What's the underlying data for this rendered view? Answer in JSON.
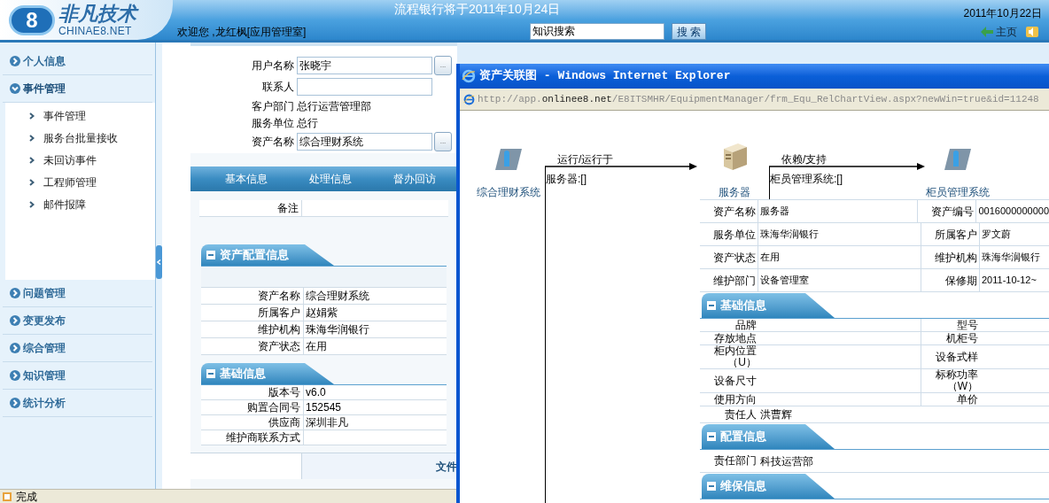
{
  "header": {
    "logo_mark": "8",
    "logo_title": "非凡技术",
    "logo_subtitle": "CHINAE8.NET",
    "welcome": "欢迎您 ,龙红枫[应用管理室]",
    "notice": "流程银行将于2011年10月24日",
    "date": "2011年10月22日",
    "search": {
      "value": "知识搜索"
    },
    "search_button": "搜 索",
    "home_link": "主页"
  },
  "sidebar": {
    "groups": [
      {
        "label": "个人信息",
        "expanded": false
      },
      {
        "label": "事件管理",
        "expanded": true,
        "children": [
          {
            "label": "事件管理"
          },
          {
            "label": "服务台批量接收"
          },
          {
            "label": "未回访事件"
          },
          {
            "label": "工程师管理"
          },
          {
            "label": "邮件报障"
          }
        ]
      },
      {
        "label": "问题管理",
        "expanded": false
      },
      {
        "label": "变更发布",
        "expanded": false
      },
      {
        "label": "综合管理",
        "expanded": false
      },
      {
        "label": "知识管理",
        "expanded": false
      },
      {
        "label": "统计分析",
        "expanded": false
      }
    ]
  },
  "form": {
    "fields": [
      {
        "label": "用户名称",
        "kind": "input",
        "value": "张晓宇",
        "picker": "..."
      },
      {
        "label": "联系人",
        "kind": "input"
      },
      {
        "label": "客户部门",
        "kind": "text",
        "value": "总行运营管理部"
      },
      {
        "label": "服务单位",
        "kind": "text",
        "value": "总行"
      },
      {
        "label": "资产名称",
        "kind": "input",
        "value": "综合理财系统",
        "picker": "..."
      }
    ]
  },
  "tabs": [
    {
      "label": "基本信息",
      "selected": false
    },
    {
      "label": "处理信息",
      "selected": false
    },
    {
      "label": "督办回访",
      "selected": false
    }
  ],
  "remark": {
    "label": "备注"
  },
  "sections": [
    {
      "title": "资产配置信息",
      "rows": [
        {
          "label": "资产名称",
          "value": "综合理财系统"
        },
        {
          "label": "所属客户",
          "value": "赵娟紫"
        },
        {
          "label": "维护机构",
          "value": "珠海华润银行"
        },
        {
          "label": "资产状态",
          "value": "在用"
        }
      ]
    },
    {
      "title": "基础信息",
      "rows": [
        {
          "label": "版本号",
          "value": "v6.0"
        },
        {
          "label": "购置合同号",
          "value": "152545"
        },
        {
          "label": "供应商",
          "value": "深圳非凡"
        },
        {
          "label": "维护商联系方式"
        }
      ]
    }
  ],
  "file_column": {
    "label": "文件"
  },
  "status_bar": {
    "text": "完成"
  },
  "popup": {
    "title": "资产关联图 - Windows Internet Explorer",
    "url": {
      "prefix": "http://app.",
      "domain": "onlinee8.net",
      "path": "/E8ITSMHR/EquipmentManager/frm_Equ_RelChartView.aspx?newWin=true&id=11248"
    },
    "diagram": {
      "nodes": [
        {
          "label": "综合理财系统",
          "kind": "application"
        },
        {
          "label": "服务器",
          "kind": "server"
        },
        {
          "label": "柜员管理系统",
          "kind": "application"
        }
      ],
      "links": [
        {
          "label": "运行/运行于",
          "detail": "服务器:[]"
        },
        {
          "label": "依赖/支持",
          "detail": "柜员管理系统:[]"
        }
      ]
    },
    "summary": [
      [
        {
          "label": "资产名称",
          "value": "服务器"
        },
        {
          "label": "资产编号",
          "value": "0016000000000"
        }
      ],
      [
        {
          "label": "服务单位",
          "value": "珠海华润银行"
        },
        {
          "label": "所属客户",
          "value": "罗文蔚"
        }
      ],
      [
        {
          "label": "资产状态",
          "value": "在用"
        },
        {
          "label": "维护机构",
          "value": "珠海华润银行"
        }
      ],
      [
        {
          "label": "维护部门",
          "value": "设备管理室"
        },
        {
          "label": "保修期",
          "value": "2011-10-12~"
        }
      ]
    ],
    "sections": [
      {
        "title": "基础信息",
        "rows": [
          [
            {
              "label": "品牌"
            },
            {
              "label": "型号"
            }
          ],
          [
            {
              "label": "存放地点"
            },
            {
              "label": "机柜号"
            }
          ],
          [
            {
              "label": "柜内位置（U）"
            },
            {
              "label": "设备式样"
            }
          ],
          [
            {
              "label": "设备尺寸"
            },
            {
              "label": "标称功率（W）"
            }
          ],
          [
            {
              "label": "使用方向"
            },
            {
              "label": "单价"
            }
          ],
          [
            {
              "label": "责任人",
              "value": "洪曹辉"
            }
          ]
        ]
      },
      {
        "title": "配置信息",
        "rows": [
          [
            {
              "label": "责任部门",
              "value": "科技运营部"
            }
          ]
        ]
      },
      {
        "title": "维保信息"
      }
    ]
  }
}
